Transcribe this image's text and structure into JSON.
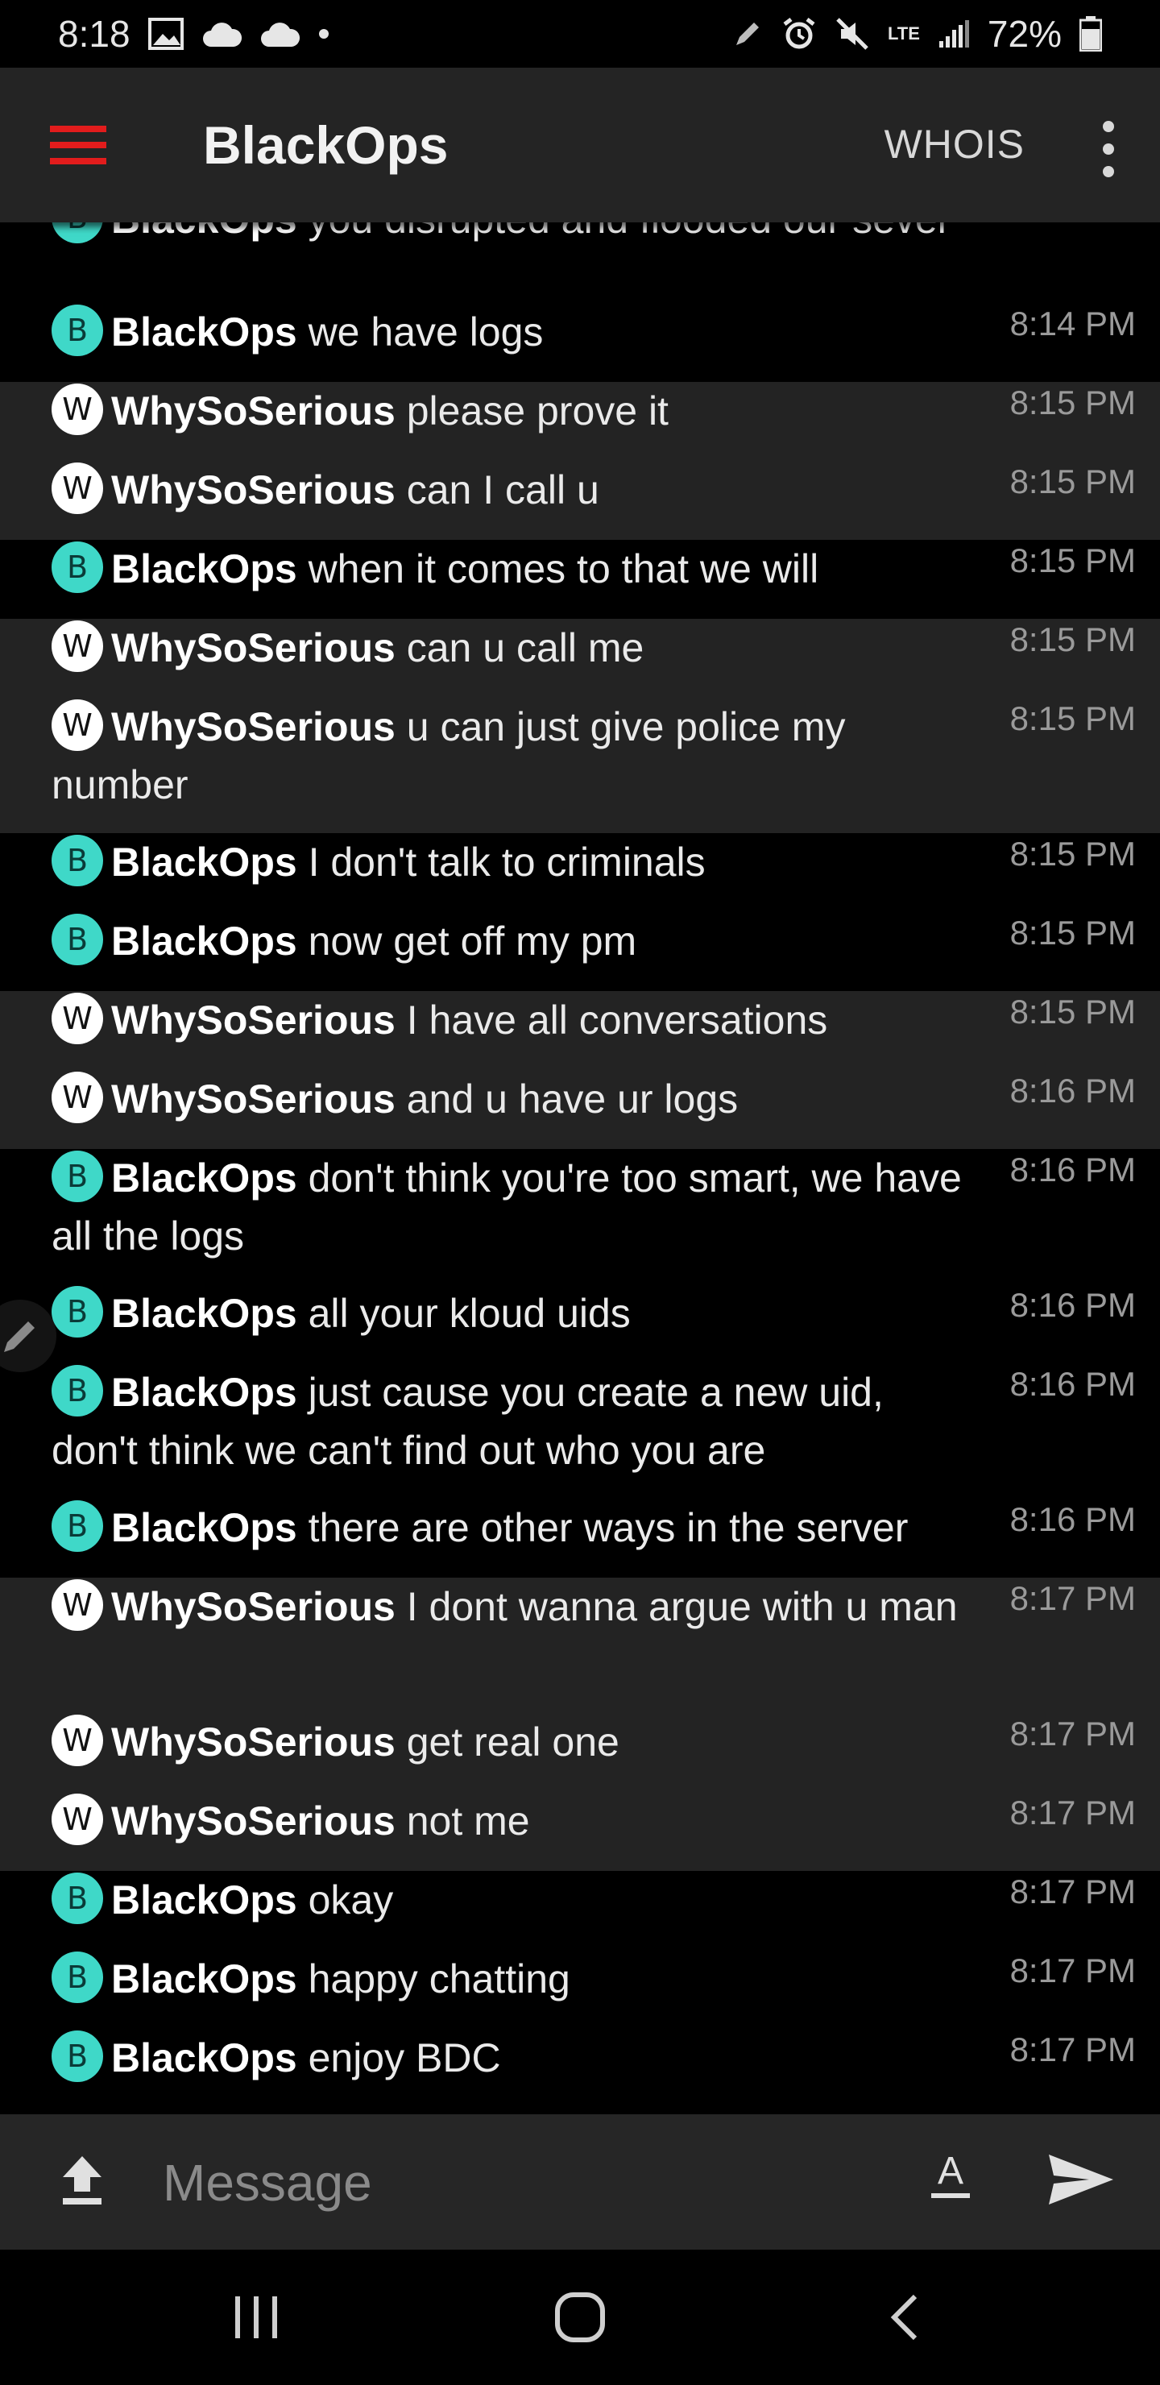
{
  "status_bar": {
    "time": "8:18",
    "network": "LTE",
    "battery": "72%"
  },
  "app_bar": {
    "title": "BlackOps",
    "whois_label": "WHOIS"
  },
  "messages": [
    {
      "type": "b",
      "nick": "BlackOps",
      "text": "you disrupted and flooded our sever",
      "time": "",
      "avatar": "B"
    },
    {
      "type": "b",
      "nick": "BlackOps",
      "text": "we have logs",
      "time": "8:14 PM",
      "avatar": "B"
    },
    {
      "type": "w",
      "nick": "WhySoSerious",
      "text": "please prove it",
      "time": "8:15 PM",
      "avatar": "W"
    },
    {
      "type": "w",
      "nick": "WhySoSerious",
      "text": "can I call u",
      "time": "8:15 PM",
      "avatar": "W"
    },
    {
      "type": "b",
      "nick": "BlackOps",
      "text": "when it comes to that we will",
      "time": "8:15 PM",
      "avatar": "B"
    },
    {
      "type": "w",
      "nick": "WhySoSerious",
      "text": "can u call me",
      "time": "8:15 PM",
      "avatar": "W"
    },
    {
      "type": "w",
      "nick": "WhySoSerious",
      "text": "u can just give police my number",
      "time": "8:15 PM",
      "avatar": "W"
    },
    {
      "type": "b",
      "nick": "BlackOps",
      "text": "I don't talk to criminals",
      "time": "8:15 PM",
      "avatar": "B"
    },
    {
      "type": "b",
      "nick": "BlackOps",
      "text": "now get off my pm",
      "time": "8:15 PM",
      "avatar": "B"
    },
    {
      "type": "w",
      "nick": "WhySoSerious",
      "text": "I have all conversations",
      "time": "8:15 PM",
      "avatar": "W"
    },
    {
      "type": "w",
      "nick": "WhySoSerious",
      "text": "and u have ur logs",
      "time": "8:16 PM",
      "avatar": "W"
    },
    {
      "type": "b",
      "nick": "BlackOps",
      "text": "don't think you're too smart, we have all the logs",
      "time": "8:16 PM",
      "avatar": "B"
    },
    {
      "type": "b",
      "nick": "BlackOps",
      "text": "all your kloud uids",
      "time": "8:16 PM",
      "avatar": "B"
    },
    {
      "type": "b",
      "nick": "BlackOps",
      "text": "just cause you create a new uid, don't think we can't find out who you are",
      "time": "8:16 PM",
      "avatar": "B"
    },
    {
      "type": "b",
      "nick": "BlackOps",
      "text": "there are other ways in the server",
      "time": "8:16 PM",
      "avatar": "B"
    },
    {
      "type": "w",
      "nick": "WhySoSerious",
      "text": "I dont wanna argue with u man",
      "time": "8:17 PM",
      "avatar": "W"
    },
    {
      "type": "w",
      "nick": "WhySoSerious",
      "text": "get real one",
      "time": "8:17 PM",
      "avatar": "W"
    },
    {
      "type": "w",
      "nick": "WhySoSerious",
      "text": "not me",
      "time": "8:17 PM",
      "avatar": "W"
    },
    {
      "type": "b",
      "nick": "BlackOps",
      "text": "okay",
      "time": "8:17 PM",
      "avatar": "B"
    },
    {
      "type": "b",
      "nick": "BlackOps",
      "text": "happy chatting",
      "time": "8:17 PM",
      "avatar": "B"
    },
    {
      "type": "b",
      "nick": "BlackOps",
      "text": "enjoy BDC",
      "time": "8:17 PM",
      "avatar": "B"
    }
  ],
  "composer": {
    "placeholder": "Message"
  },
  "icons": {
    "menu": "hamburger-icon",
    "overflow": "more-vert-icon",
    "upload": "upload-icon",
    "format": "text-format-icon",
    "send": "send-icon"
  },
  "colors": {
    "accent_menu": "#e21c1c",
    "blackops_avatar": "#3fd8c8",
    "whysoserious_avatar": "#ffffff",
    "row_dark": "#000000",
    "row_grey": "#232323"
  }
}
